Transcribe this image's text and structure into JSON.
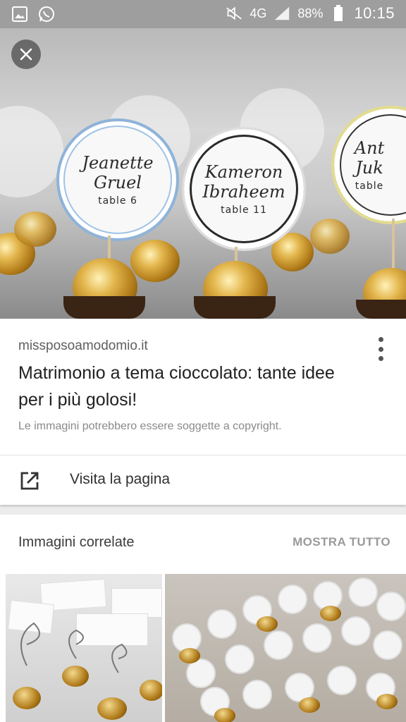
{
  "status_bar": {
    "network": "4G",
    "battery": "88%",
    "time": "10:15",
    "icons": [
      "gallery-icon",
      "whatsapp-icon",
      "mute-icon",
      "signal-icon",
      "battery-icon"
    ]
  },
  "hero": {
    "tags": [
      {
        "name_line1": "Jeanette",
        "name_line2": "Gruel",
        "table": "table 6"
      },
      {
        "name_line1": "Kameron",
        "name_line2": "Ibraheem",
        "table": "table 11"
      },
      {
        "name_line1": "Ant",
        "name_line2": "Juk",
        "table": "table"
      }
    ]
  },
  "info": {
    "domain": "missposoamodomio.it",
    "title": "Matrimonio a tema cioccolato: tante idee per i più golosi!",
    "copyright": "Le immagini potrebbero essere soggette a copyright.",
    "visit_label": "Visita la pagina"
  },
  "related": {
    "heading": "Immagini correlate",
    "show_all": "MOSTRA TUTTO"
  },
  "colors": {
    "status_bar_bg": "#9e9e9e",
    "page_bg": "#ececec",
    "card_bg": "#ffffff",
    "gold": "#c9962a"
  }
}
